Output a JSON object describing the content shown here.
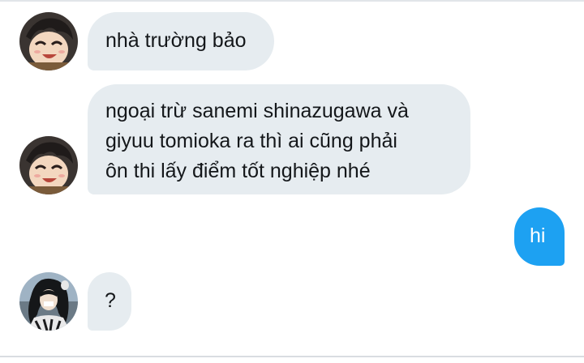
{
  "conversation": {
    "messages": [
      {
        "sender": "other",
        "avatar": "anime-avatar-smiling",
        "text": "nhà trường bảo"
      },
      {
        "sender": "other",
        "avatar": "anime-avatar-smiling",
        "lines": [
          "ngoại trừ sanemi shinazugawa và",
          "giyuu tomioka ra thì ai cũng phải",
          "ôn thi lấy điểm tốt nghiệp nhé"
        ]
      },
      {
        "sender": "self",
        "text": "hi"
      },
      {
        "sender": "other",
        "avatar": "anime-avatar-dark-hair",
        "text": "?"
      }
    ]
  },
  "colors": {
    "incoming_bubble": "#e6ecf0",
    "outgoing_bubble": "#1da1f2",
    "text": "#14171a"
  }
}
